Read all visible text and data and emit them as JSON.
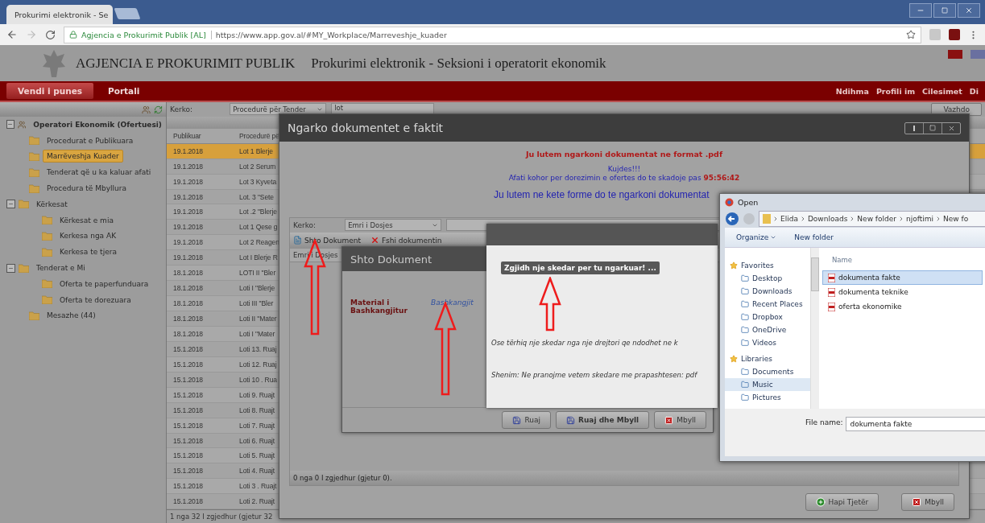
{
  "browser": {
    "tab_title": "Prokurimi elektronik - Se",
    "site_name": "Agjencia e Prokurimit Publik [AL]",
    "url": "https://www.app.gov.al/#MY_Workplace/Marreveshje_kuader"
  },
  "header": {
    "agency": "AGJENCIA E PROKURIMIT PUBLIK",
    "subtitle": "Prokurimi elektronik - Seksioni i operatorit ekonomik"
  },
  "nav": {
    "tabs": [
      {
        "label": "Vendi i punes",
        "selected": true
      },
      {
        "label": "Portali",
        "selected": false
      }
    ],
    "links": [
      "Ndihma",
      "Profili im",
      "Cilesimet",
      "Di"
    ]
  },
  "sidebar": {
    "tree": [
      {
        "label": "Operatori Ekonomik (Ofertuesi)",
        "selected": false,
        "expanded": true,
        "children": [
          {
            "label": "Procedurat e Publikuara",
            "selected": false
          },
          {
            "label": "Marrëveshja Kuader",
            "selected": true
          },
          {
            "label": "Tenderat që u ka kaluar afati",
            "selected": false
          },
          {
            "label": "Procedura të Mbyllura",
            "selected": false
          },
          {
            "label": "Kërkesat",
            "selected": false,
            "expanded": true,
            "children": [
              {
                "label": "Kërkesat e mia",
                "selected": false
              },
              {
                "label": "Kerkesa nga AK",
                "selected": false
              },
              {
                "label": "Kerkesa te tjera",
                "selected": false
              }
            ]
          },
          {
            "label": "Tenderat e Mi",
            "selected": false,
            "expanded": true,
            "children": [
              {
                "label": "Oferta te paperfunduara",
                "selected": false
              },
              {
                "label": "Oferta te dorezuara",
                "selected": false
              }
            ]
          },
          {
            "label": "Mesazhe (44)",
            "selected": false
          }
        ]
      }
    ]
  },
  "search": {
    "label": "Kerko:",
    "select": "Procedurë për Tender",
    "value": "lot",
    "button": "Vazhdo"
  },
  "table": {
    "columns": [
      "Publikuar",
      "Procedurë pë"
    ],
    "rows": [
      {
        "cells": [
          "19.1.2018",
          "Lot 1 Blerje"
        ],
        "selected": true
      },
      {
        "cells": [
          "19.1.2018",
          "Lot 2 Serum"
        ],
        "selected": false
      },
      {
        "cells": [
          "19.1.2018",
          "Lot 3 Kyveta"
        ],
        "selected": false
      },
      {
        "cells": [
          "19.1.2018",
          "Lot. 3 \"Sete"
        ],
        "selected": false
      },
      {
        "cells": [
          "19.1.2018",
          "Lot .2 \"Blerje"
        ],
        "selected": false
      },
      {
        "cells": [
          "19.1.2018",
          "Lot 1 Qese g"
        ],
        "selected": false
      },
      {
        "cells": [
          "19.1.2018",
          "Lot 2 Reagen"
        ],
        "selected": false
      },
      {
        "cells": [
          "19.1.2018",
          "Lot I Blerje R"
        ],
        "selected": false
      },
      {
        "cells": [
          "18.1.2018",
          "LOTI II \"Bler"
        ],
        "selected": false
      },
      {
        "cells": [
          "18.1.2018",
          "Loti I \"Blerje"
        ],
        "selected": false
      },
      {
        "cells": [
          "18.1.2018",
          "Loti III \"Bler"
        ],
        "selected": false
      },
      {
        "cells": [
          "18.1.2018",
          "Loti II \"Mater"
        ],
        "selected": false
      },
      {
        "cells": [
          "18.1.2018",
          "Loti I \"Mater"
        ],
        "selected": false
      },
      {
        "cells": [
          "15.1.2018",
          "Loti 13. Ruaj"
        ],
        "selected": false
      },
      {
        "cells": [
          "15.1.2018",
          "Loti 12. Ruaj"
        ],
        "selected": false
      },
      {
        "cells": [
          "15.1.2018",
          "Loti 10 . Rua"
        ],
        "selected": false
      },
      {
        "cells": [
          "15.1.2018",
          "Loti 9. Ruajt"
        ],
        "selected": false
      },
      {
        "cells": [
          "15.1.2018",
          "Loti 8. Ruajt"
        ],
        "selected": false
      },
      {
        "cells": [
          "15.1.2018",
          "Loti 7. Ruajt"
        ],
        "selected": false
      },
      {
        "cells": [
          "15.1.2018",
          "Loti 6. Ruajt"
        ],
        "selected": false
      },
      {
        "cells": [
          "15.1.2018",
          "Loti 5. Ruajt"
        ],
        "selected": false
      },
      {
        "cells": [
          "15.1.2018",
          "Loti 4. Ruajt"
        ],
        "selected": false
      },
      {
        "cells": [
          "15.1.2018",
          "Loti 3 . Ruajt"
        ],
        "selected": false
      },
      {
        "cells": [
          "15.1.2018",
          "Loti 2. Ruajt"
        ],
        "selected": false
      }
    ],
    "footer": "1 nga 32 I zgjedhur (gjetur 32"
  },
  "upload_dialog": {
    "title": "Ngarko dokumentet e faktit",
    "format_note": "Ju lutem ngarkoni dokumentat ne format .pdf",
    "warning": "Kujdes!!!",
    "deadline": "Afati kohor per dorezimin e ofertes do te skadoje pas",
    "countdown": "95:56:42",
    "instruction": "Ju lutem ne kete forme do te ngarkoni dokumentat",
    "grid": {
      "search_label": "Kerko:",
      "search_select": "Emri i Dosjes",
      "toolbar": [
        "Shto Dokument",
        "Fshi dokumentin"
      ],
      "column": "Emri i Dosjes",
      "status": "0 nga 0 I zgjedhur (gjetur 0)."
    },
    "buttons": [
      "Hapi Tjetër",
      "Mbyll"
    ]
  },
  "add_dialog": {
    "title": "Shto Dokument",
    "field_label": "Material i Bashkangjitur",
    "link": "Bashkangjit",
    "buttons": [
      "Ruaj",
      "Ruaj dhe Mbyll",
      "Mbyll"
    ]
  },
  "file_panel": {
    "choose_button": "Zgjidh nje skedar per tu ngarkuar! ...",
    "drop_text": "Ose tërhiq nje skedar nga nje drejtori qe ndodhet ne k",
    "note": "Shenim: Ne pranojme vetem skedare me prapashtesen: pdf"
  },
  "open_dialog": {
    "title": "Open",
    "breadcrumb": [
      "Elida",
      "Downloads",
      "New folder",
      "njoftimi",
      "New fo"
    ],
    "toolbar": [
      "Organize",
      "New folder"
    ],
    "nav": [
      {
        "label": "Favorites",
        "kind": "group",
        "selected": false
      },
      {
        "label": "Desktop",
        "kind": "item",
        "selected": false
      },
      {
        "label": "Downloads",
        "kind": "item",
        "selected": false
      },
      {
        "label": "Recent Places",
        "kind": "item",
        "selected": false
      },
      {
        "label": "Dropbox",
        "kind": "item",
        "selected": false
      },
      {
        "label": "OneDrive",
        "kind": "item",
        "selected": false
      },
      {
        "label": "Videos",
        "kind": "item",
        "selected": false
      },
      {
        "label": "Libraries",
        "kind": "group",
        "selected": false
      },
      {
        "label": "Documents",
        "kind": "item",
        "selected": false
      },
      {
        "label": "Music",
        "kind": "item",
        "selected": true
      },
      {
        "label": "Pictures",
        "kind": "item",
        "selected": false
      }
    ],
    "column": "Name",
    "files": [
      {
        "name": "dokumenta fakte",
        "selected": true
      },
      {
        "name": "dokumenta teknike",
        "selected": false
      },
      {
        "name": "oferta ekonomike",
        "selected": false
      }
    ],
    "file_name_label": "File name:",
    "file_name": "dokumenta fakte"
  }
}
